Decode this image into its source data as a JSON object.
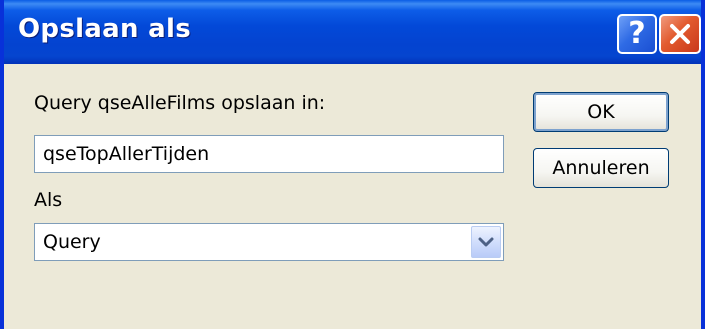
{
  "window": {
    "title": "Opslaan als"
  },
  "titlebar": {
    "help_glyph": "?",
    "help_icon": "question-mark-icon",
    "close_icon": "close-x-icon"
  },
  "form": {
    "save_label": "Query qseAlleFilms opslaan in:",
    "name_value": "qseTopAllerTijden",
    "as_label": "Als",
    "type_selected": "Query",
    "type_arrow_icon": "chevron-down-icon"
  },
  "buttons": {
    "ok_label": "OK",
    "cancel_label": "Annuleren"
  },
  "colors": {
    "titlebar_blue": "#0349D8",
    "window_border": "#0831D9",
    "dialog_face": "#ECE9D8",
    "close_red": "#E25A2E",
    "field_border": "#7F9DB9"
  }
}
